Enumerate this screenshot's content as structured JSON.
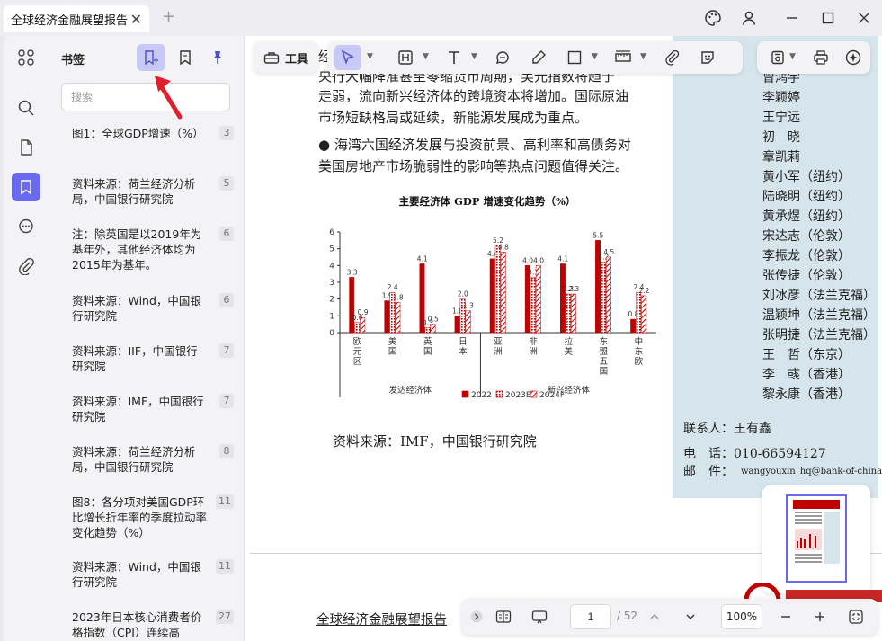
{
  "window": {
    "tab_title": "全球经济金融展望报告",
    "close_tab": "✕",
    "new_tab": "+"
  },
  "sidebar": {
    "title": "书签",
    "search_placeholder": "搜索",
    "bookmarks": [
      {
        "text": "图1：全球GDP增速（%）",
        "page": "3"
      },
      {
        "text": "资料来源：荷兰经济分析局，中国银行研究院",
        "page": "5"
      },
      {
        "text": "注：除英国是以2019年为基年外，其他经济体均为2015年为基年。",
        "page": "6"
      },
      {
        "text": "资料来源：Wind，中国银行研究院",
        "page": "6"
      },
      {
        "text": "资料来源：IIF，中国银行研究院",
        "page": "7"
      },
      {
        "text": "资料来源：IMF，中国银行研究院",
        "page": "7"
      },
      {
        "text": "资料来源：荷兰经济分析局，中国银行研究院",
        "page": "8"
      },
      {
        "text": "图8：各分项对美国GDP环比增长折年率的季度拉动率变化趋势（%）",
        "page": "11"
      },
      {
        "text": "资料来源：Wind，中国银行研究院",
        "page": "11"
      },
      {
        "text": "2023年日本核心消费者价格指数（CPI）连续高",
        "page": "27"
      }
    ]
  },
  "toolbar": {
    "tools_label": "工具"
  },
  "document": {
    "lines": [
      "经",
      "央行大幅降准甚至零缩货币周期，美元指数将趋于",
      "走弱，流向新兴经济体的跨境资本将增加。国际原油",
      "市场短缺格局或延续，新能源发展成为重点。",
      "● 海湾六国经济发展与投资前景、高利率和高债务对",
      "美国房地产市场脆弱性的影响等热点问题值得关注。"
    ],
    "source": "资料来源：IMF，中国银行研究院",
    "footer_title": "全球经济金融展望报告",
    "contacts": [
      "曾鸿宇",
      "李颖婷",
      "王宁远",
      "初　晓",
      "章凯莉",
      "黄小军（纽约）",
      "陆晓明（纽约）",
      "黄承煜（纽约）",
      "宋达志（伦敦）",
      "李振龙（伦敦）",
      "张传捷（伦敦）",
      "刘冰彦（法兰克福）",
      "温颖坤（法兰克福）",
      "张明捷（法兰克福）",
      "王　哲（东京）",
      "李　彧（香港）",
      "黎永康（香港）"
    ],
    "contact_person": "联系人：王有鑫",
    "phone": "电　话：010-66594127",
    "email_label": "邮　件：",
    "email": "wangyouxin_hq@bank-of-china.com"
  },
  "chart_data": {
    "type": "bar",
    "title": "主要经济体 GDP 增速变化趋势（%）",
    "categories": [
      "欧元区",
      "美国",
      "英国",
      "日本",
      "亚洲",
      "非洲",
      "拉美",
      "东盟五国",
      "中东欧"
    ],
    "groups": [
      {
        "label": "发达经济体",
        "count": 4
      },
      {
        "label": "新兴经济体",
        "count": 5
      }
    ],
    "series": [
      {
        "name": "2022",
        "values": [
          3.3,
          1.9,
          4.1,
          1.0,
          4.4,
          4.0,
          4.1,
          5.5,
          0.8
        ],
        "color": "#c00000"
      },
      {
        "name": "2023E",
        "values": [
          0.6,
          2.4,
          0.3,
          2.0,
          5.2,
          3.3,
          2.3,
          4.2,
          2.4
        ],
        "color": "#e8a0a0"
      },
      {
        "name": "2024F",
        "values": [
          0.9,
          1.8,
          0.5,
          1.3,
          4.8,
          4.0,
          2.3,
          4.5,
          2.2
        ],
        "color": "#c00000"
      }
    ],
    "ylim": [
      0,
      6
    ],
    "yticks": [
      0,
      1,
      2,
      3,
      4,
      5,
      6
    ]
  },
  "navbar": {
    "page_current": "1",
    "page_total": "/ 52",
    "zoom": "100%"
  }
}
